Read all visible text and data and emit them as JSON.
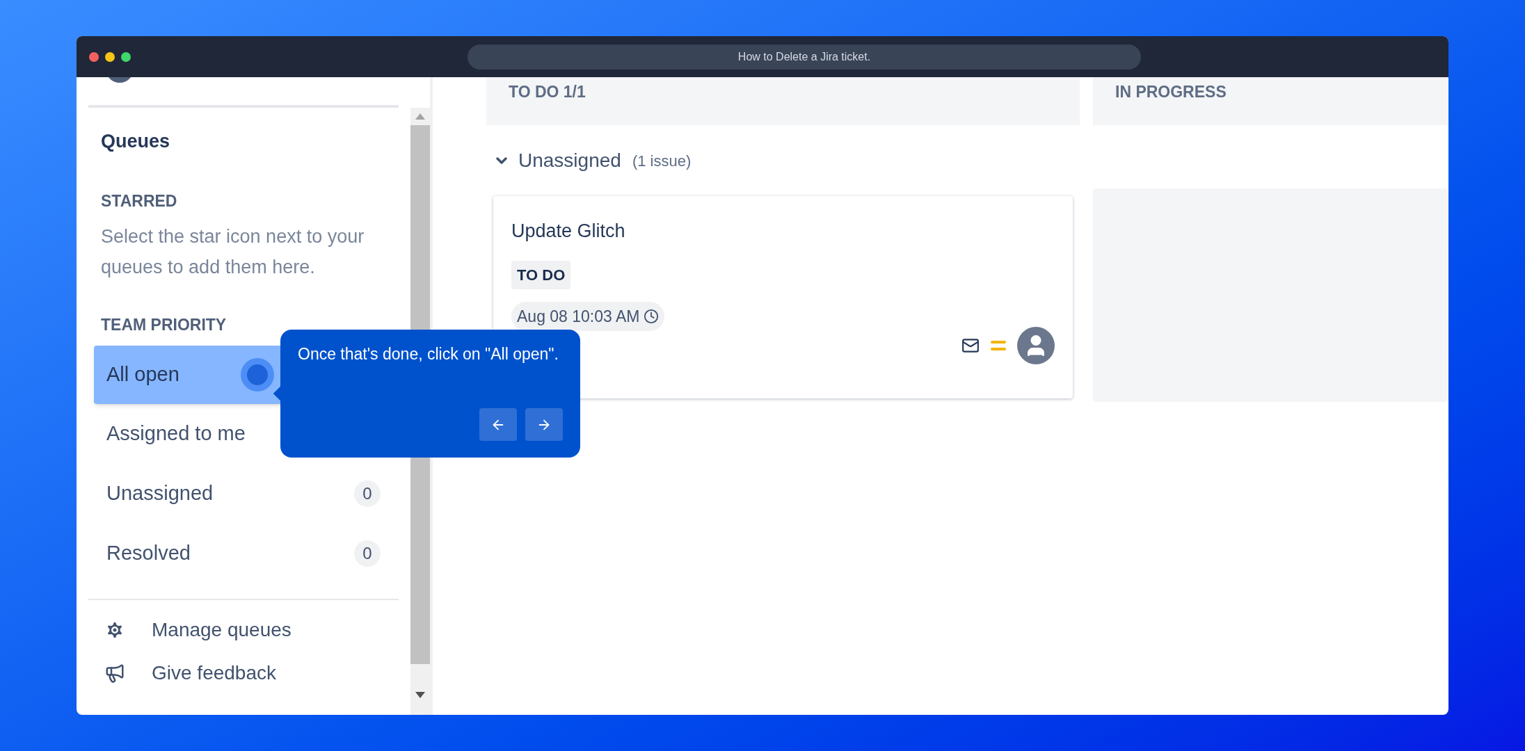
{
  "window": {
    "title": "How to Delete a Jira ticket."
  },
  "sidebar": {
    "heading": "Queues",
    "starred": {
      "heading": "STARRED",
      "hint": "Select the star icon next to your queues to add them here."
    },
    "team_priority": {
      "heading": "TEAM PRIORITY",
      "queues": [
        {
          "label": "All open",
          "selected": true
        },
        {
          "label": "Assigned to me",
          "selected": false
        },
        {
          "label": "Unassigned",
          "count": "0",
          "selected": false
        },
        {
          "label": "Resolved",
          "count": "0",
          "selected": false
        }
      ]
    },
    "footer": [
      {
        "label": "Manage queues",
        "kind": "settings"
      },
      {
        "label": "Give feedback",
        "kind": "feedback"
      }
    ]
  },
  "board": {
    "columns": [
      {
        "title": "TO DO 1/1"
      },
      {
        "title": "IN PROGRESS"
      }
    ],
    "group": {
      "label": "Unassigned",
      "count": "(1 issue)",
      "expanded": true
    },
    "card": {
      "title": "Update Glitch",
      "status": "TO DO",
      "date": "Aug 08 10:03 AM"
    }
  },
  "tooltip": {
    "text": "Once that's done, click on \"All open\"."
  }
}
